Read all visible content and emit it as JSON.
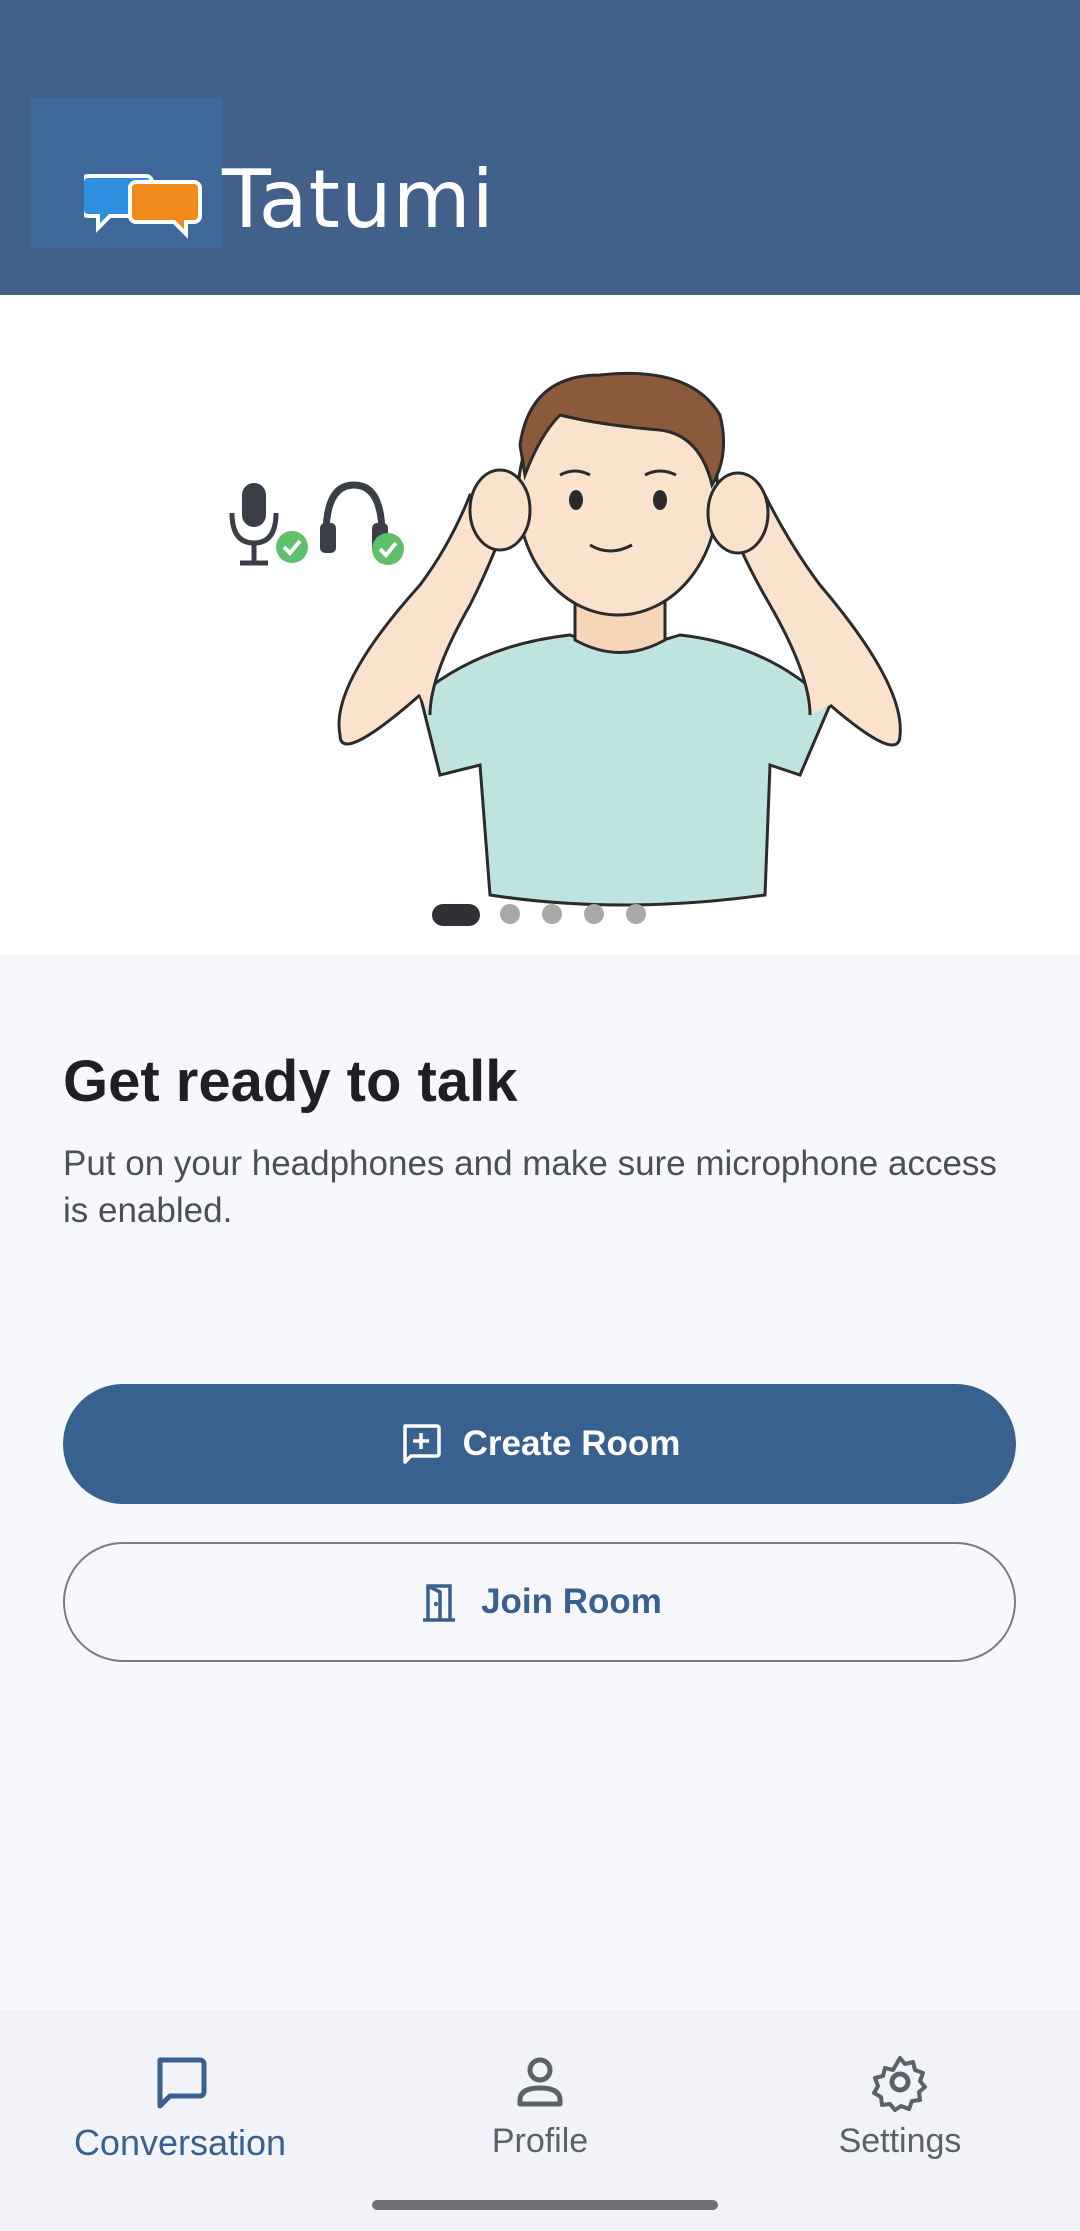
{
  "header": {
    "app_name": "Tatumi",
    "logo_icon": "chat-bubbles-logo"
  },
  "hero": {
    "illustration": "person-putting-on-earbuds",
    "status_icons": [
      "microphone-check-icon",
      "headphones-check-icon"
    ],
    "carousel": {
      "total_pages": 5,
      "current_page": 1
    }
  },
  "content": {
    "title": "Get ready to talk",
    "description": "Put on your headphones and make sure microphone access is enabled."
  },
  "actions": {
    "create_room": "Create Room",
    "join_room": "Join Room"
  },
  "bottom_nav": {
    "items": [
      {
        "label": "Conversation",
        "icon": "chat-icon",
        "active": true
      },
      {
        "label": "Profile",
        "icon": "person-icon",
        "active": false
      },
      {
        "label": "Settings",
        "icon": "gear-icon",
        "active": false
      }
    ]
  },
  "colors": {
    "header": "#41618a",
    "primary": "#38618f",
    "background": "#f7f8fc"
  }
}
